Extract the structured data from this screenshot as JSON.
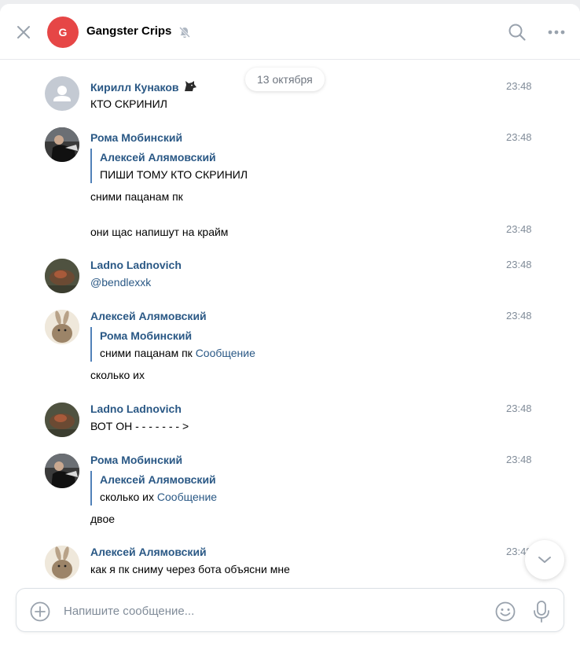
{
  "chat": {
    "title": "Gangster Crips",
    "avatar_letter": "G",
    "avatar_color": "#e64646",
    "muted": true
  },
  "header_icons": [
    "close-icon",
    "muted-bell-icon",
    "search-icon",
    "more-icon"
  ],
  "date_divider": "13 октября",
  "messages": [
    {
      "author": "Кирилл Кунаков",
      "author_badge": "wolf-emoji",
      "time": "23:48",
      "text": "КТО СКРИНИЛ"
    },
    {
      "author": "Рома Мобинский",
      "time": "23:48",
      "reply": {
        "author": "Алексей Алямовский",
        "text": "ПИШИ ТОМУ КТО СКРИНИЛ"
      },
      "text": "сними пацанам пк"
    },
    {
      "author": "Рома Мобинский",
      "time": "23:48",
      "text": "они щас напишут на крайм",
      "continuation": true
    },
    {
      "author": "Ladno Ladnovich",
      "time": "23:48",
      "text": "@bendlexxk"
    },
    {
      "author": "Алексей Алямовский",
      "time": "23:48",
      "reply": {
        "author": "Рома Мобинский",
        "text": "сними пацанам пк",
        "link": "Сообщение"
      },
      "text": "сколько их"
    },
    {
      "author": "Ladno Ladnovich",
      "time": "23:48",
      "text": "ВОТ ОН - - - - - - - >"
    },
    {
      "author": "Рома Мобинский",
      "time": "23:48",
      "reply": {
        "author": "Алексей Алямовский",
        "text": "сколько их",
        "link": "Сообщение"
      },
      "text": "двое"
    },
    {
      "author": "Алексей Алямовский",
      "time": "23:48",
      "text": "как я пк сниму через бота объясни мне"
    }
  ],
  "composer": {
    "placeholder": "Напишите сообщение..."
  },
  "colors": {
    "accent": "#2a5885",
    "link": "#5181b8",
    "time": "#818c99",
    "background": "#edeef0"
  }
}
